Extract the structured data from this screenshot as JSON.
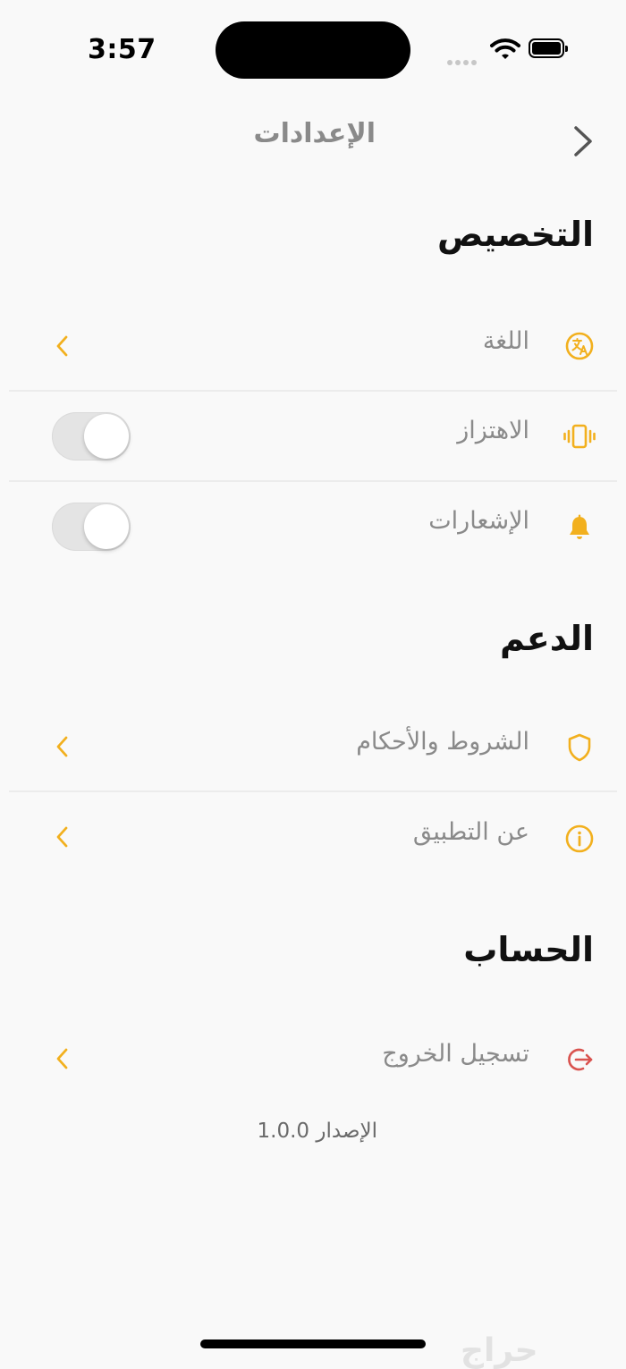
{
  "status_bar": {
    "time": "3:57"
  },
  "header": {
    "title": "الإعدادات",
    "back_icon": "chevron-right-icon"
  },
  "sections": {
    "personalization": {
      "title": "التخصيص",
      "language": {
        "label": "اللغة",
        "icon": "translate-icon"
      },
      "vibration": {
        "label": "الاهتزاز",
        "icon": "vibration-icon",
        "toggle_on": false
      },
      "notifications": {
        "label": "الإشعارات",
        "icon": "bell-icon",
        "toggle_on": false
      }
    },
    "support": {
      "title": "الدعم",
      "terms": {
        "label": "الشروط والأحكام",
        "icon": "shield-icon"
      },
      "about": {
        "label": "عن التطبيق",
        "icon": "info-icon"
      }
    },
    "account": {
      "title": "الحساب",
      "logout": {
        "label": "تسجيل الخروج",
        "icon": "logout-icon"
      }
    }
  },
  "version": "الإصدار 1.0.0",
  "watermark": "حراج",
  "colors": {
    "accent": "#f2b01e",
    "danger": "#d9534f",
    "background": "#f9f9f9",
    "muted_text": "#8a8a8a"
  }
}
